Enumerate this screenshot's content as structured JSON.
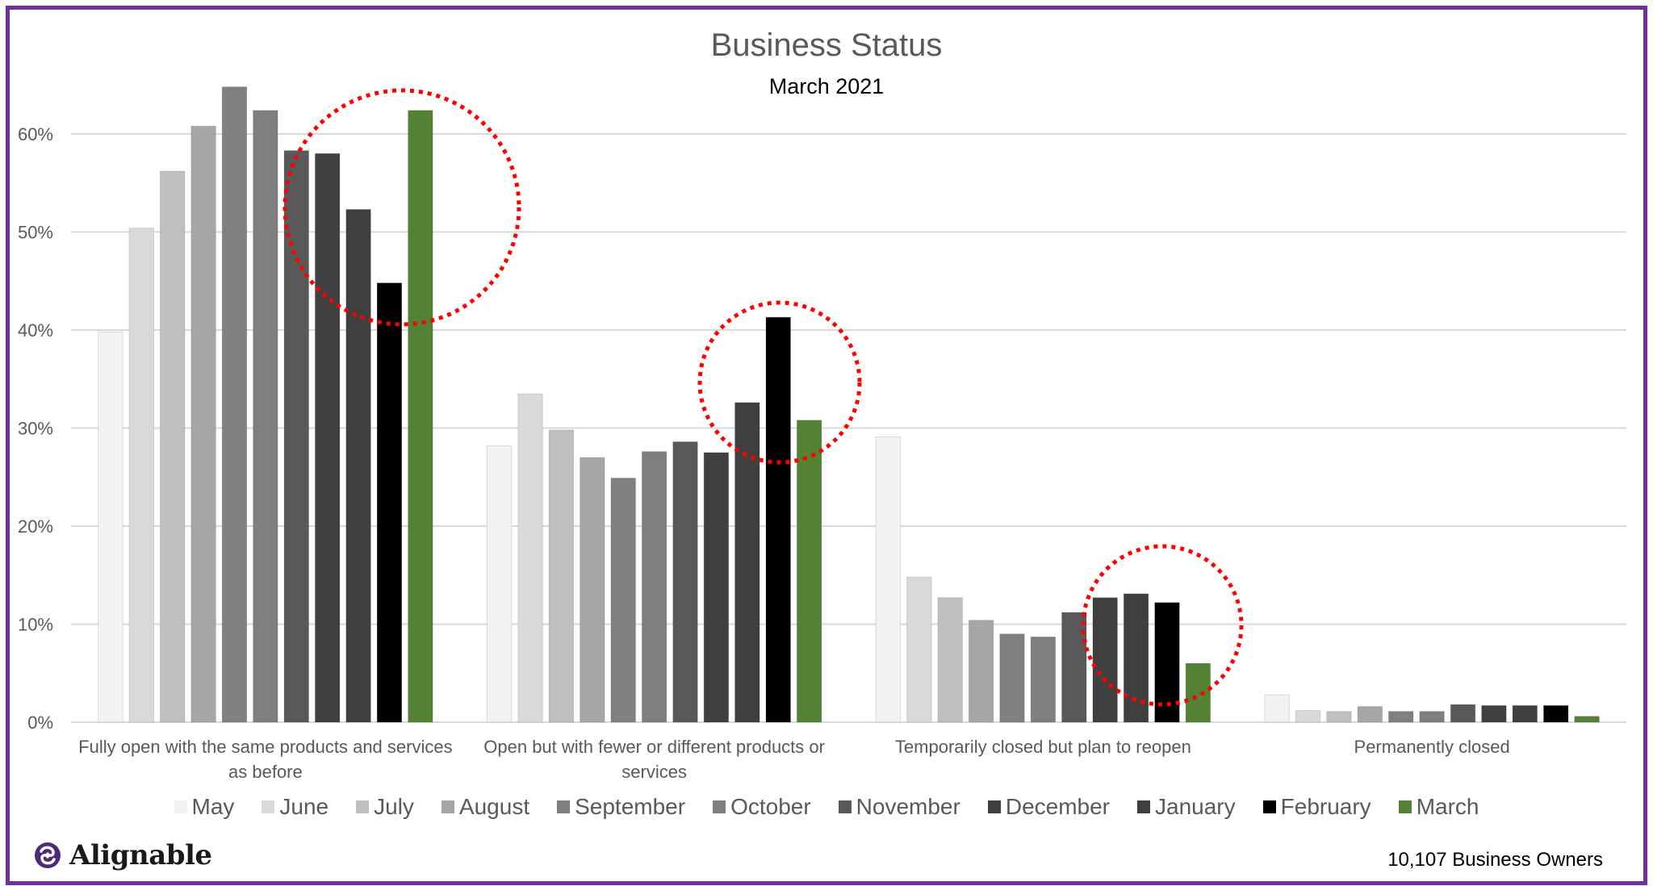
{
  "chart_data": {
    "type": "bar",
    "title": "Business Status",
    "subtitle": "March 2021",
    "xlabel": "",
    "ylabel": "",
    "ylim": [
      0,
      65
    ],
    "yticks": [
      0,
      10,
      20,
      30,
      40,
      50,
      60
    ],
    "ytick_labels": [
      "0%",
      "10%",
      "20%",
      "30%",
      "40%",
      "50%",
      "60%"
    ],
    "grid": true,
    "legend_position": "bottom",
    "categories": [
      [
        "Fully open with the same products and services",
        "as before"
      ],
      [
        "Open but with fewer or different products or",
        "services"
      ],
      [
        "Temporarily closed but plan to reopen"
      ],
      [
        "Permanently closed"
      ]
    ],
    "series": [
      {
        "name": "May",
        "color": "#F2F2F2",
        "values": [
          39.8,
          28.2,
          29.1,
          2.8
        ]
      },
      {
        "name": "June",
        "color": "#D9D9D9",
        "values": [
          50.4,
          33.5,
          14.8,
          1.2
        ]
      },
      {
        "name": "July",
        "color": "#BFBFBF",
        "values": [
          56.2,
          29.8,
          12.7,
          1.1
        ]
      },
      {
        "name": "August",
        "color": "#A6A6A6",
        "values": [
          60.8,
          27.0,
          10.4,
          1.6
        ]
      },
      {
        "name": "September",
        "color": "#808080",
        "values": [
          64.8,
          24.9,
          9.0,
          1.1
        ]
      },
      {
        "name": "October",
        "color": "#7F7F7F",
        "values": [
          62.4,
          27.6,
          8.7,
          1.1
        ]
      },
      {
        "name": "November",
        "color": "#595959",
        "values": [
          58.3,
          28.6,
          11.2,
          1.8
        ]
      },
      {
        "name": "December",
        "color": "#404040",
        "values": [
          58.0,
          27.5,
          12.7,
          1.7
        ]
      },
      {
        "name": "January",
        "color": "#3F3F3F",
        "values": [
          52.3,
          32.6,
          13.1,
          1.7
        ]
      },
      {
        "name": "February",
        "color": "#000000",
        "values": [
          44.8,
          41.3,
          12.2,
          1.7
        ]
      },
      {
        "name": "March",
        "color": "#548235",
        "values": [
          62.4,
          30.8,
          6.0,
          0.6
        ]
      }
    ],
    "annotations": [
      {
        "type": "dotted-circle",
        "color": "#FF0000",
        "highlights": "Fully open: November–March"
      },
      {
        "type": "dotted-circle",
        "color": "#FF0000",
        "highlights": "Open but fewer: January–March"
      },
      {
        "type": "dotted-circle",
        "color": "#FF0000",
        "highlights": "Temporarily closed: December–March"
      }
    ]
  },
  "branding": {
    "logo_text": "Alignable",
    "logo_color": "#4B2A7B",
    "frame_color": "#7030A0"
  },
  "footer": {
    "respondents": "10,107 Business Owners"
  }
}
